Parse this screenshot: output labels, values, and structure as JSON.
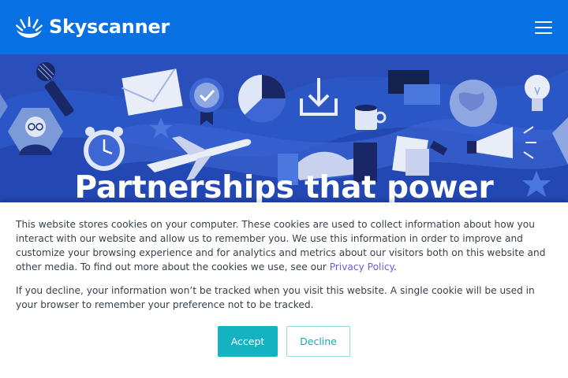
{
  "colors": {
    "header_bg": "#0770e3",
    "hero_bg": "#2a56c6",
    "accept_bg": "#15b3c2",
    "link": "#6e5bd9"
  },
  "header": {
    "logo_text": "Skyscanner",
    "logo_icon": "sunrise-icon",
    "menu_icon": "hamburger-menu-icon"
  },
  "hero": {
    "title": "Partnerships that power",
    "illustration_icons": [
      "microphone-icon",
      "envelope-icon",
      "award-badge-icon",
      "pie-chart-icon",
      "download-icon",
      "chat-bubbles-icon",
      "globe-icon",
      "lightbulb-icon",
      "person-avatar-icon",
      "alarm-clock-icon",
      "airplane-icon",
      "handshake-icon",
      "coffee-cup-icon",
      "documents-icon",
      "megaphone-icon",
      "star-icon"
    ]
  },
  "cookie_banner": {
    "paragraph1_text": "This website stores cookies on your computer. These cookies are used to collect information about how you interact with our website and allow us to remember you. We use this information in order to improve and customize your browsing experience and for analytics and metrics about our visitors both on this website and other media. To find out more about the cookies we use, see our ",
    "privacy_link": "Privacy Policy",
    "paragraph1_end": ".",
    "paragraph2": "If you decline, your information won’t be tracked when you visit this website. A single cookie will be used in your browser to remember your preference not to be tracked.",
    "accept_label": "Accept",
    "decline_label": "Decline"
  }
}
